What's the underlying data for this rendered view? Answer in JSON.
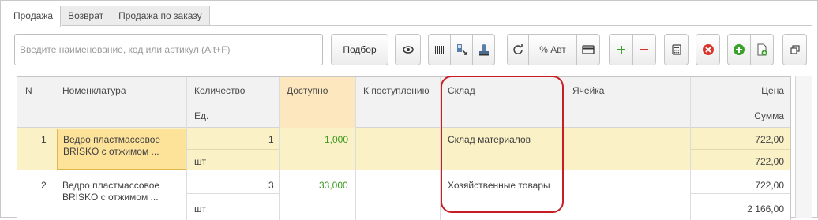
{
  "tabs": [
    "Продажа",
    "Возврат",
    "Продажа по заказу"
  ],
  "search": {
    "placeholder": "Введите наименование, код или артикул (Alt+F)"
  },
  "toolbar": {
    "select_label": "Подбор",
    "percent_label": "% Авт",
    "icons": [
      "eye-icon",
      "barcode-icon",
      "scanner-icon",
      "stamp-icon",
      "refresh-icon",
      "card-icon",
      "plus-icon",
      "minus-icon",
      "calculator-icon",
      "delete-icon",
      "add-green-icon",
      "doc-add-icon",
      "window-icon"
    ]
  },
  "table": {
    "headers": {
      "n": "N",
      "item": "Номенклатура",
      "qty": "Количество",
      "unit": "Ед.",
      "avail": "Доступно",
      "incoming": "К поступлению",
      "warehouse": "Склад",
      "cell": "Ячейка",
      "price": "Цена",
      "sum": "Сумма"
    },
    "rows": [
      {
        "n": "1",
        "item": "Ведро пластмассовое BRISKO с отжимом ...",
        "item_line1": "Ведро пластмассовое",
        "item_line2": "BRISKO с отжимом ...",
        "qty": "1",
        "unit": "шт",
        "avail": "1,000",
        "warehouse": "Склад материалов",
        "price": "722,00",
        "sum": "722,00"
      },
      {
        "n": "2",
        "item": "Ведро пластмассовое BRISKO с отжимом ...",
        "item_line1": "Ведро пластмассовое",
        "item_line2": "BRISKO с отжимом ...",
        "qty": "3",
        "unit": "шт",
        "avail": "33,000",
        "warehouse": "Хозяйственные товары",
        "price": "722,00",
        "sum": "2 166,00"
      }
    ]
  },
  "colors": {
    "highlight_row": "#fbf1c6",
    "available_header": "#fde7bf",
    "accent_red": "#c81d25",
    "green_value": "#3a9a1e"
  }
}
